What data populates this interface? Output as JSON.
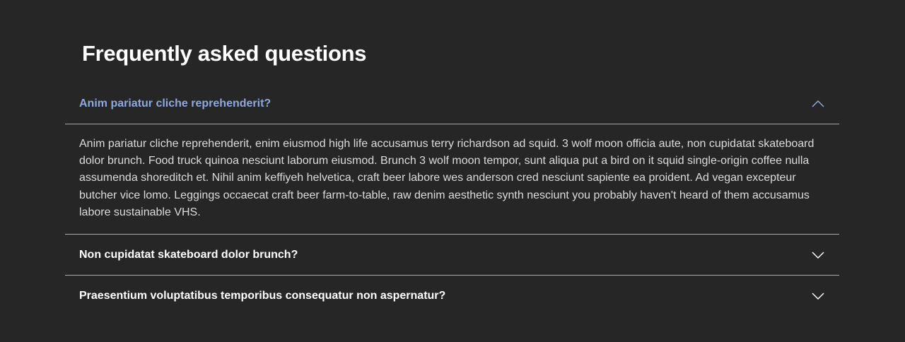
{
  "page": {
    "title": "Frequently asked questions"
  },
  "faq": [
    {
      "question": "Anim pariatur cliche reprehenderit?",
      "expanded": true,
      "answer": "Anim pariatur cliche reprehenderit, enim eiusmod high life accusamus terry richardson ad squid. 3 wolf moon officia aute, non cupidatat skateboard dolor brunch. Food truck quinoa nesciunt laborum eiusmod. Brunch 3 wolf moon tempor, sunt aliqua put a bird on it squid single-origin coffee nulla assumenda shoreditch et. Nihil anim keffiyeh helvetica, craft beer labore wes anderson cred nesciunt sapiente ea proident. Ad vegan excepteur butcher vice lomo. Leggings occaecat craft beer farm-to-table, raw denim aesthetic synth nesciunt you probably haven't heard of them accusamus labore sustainable VHS.",
      "icon": "chevron-up-icon"
    },
    {
      "question": "Non cupidatat skateboard dolor brunch?",
      "expanded": false,
      "icon": "chevron-down-icon"
    },
    {
      "question": "Praesentium voluptatibus temporibus consequatur non aspernatur?",
      "expanded": false,
      "icon": "chevron-down-icon"
    }
  ],
  "colors": {
    "background": "#262626",
    "accent_question": "#8ea9dc",
    "divider": "#a9a9a9"
  }
}
